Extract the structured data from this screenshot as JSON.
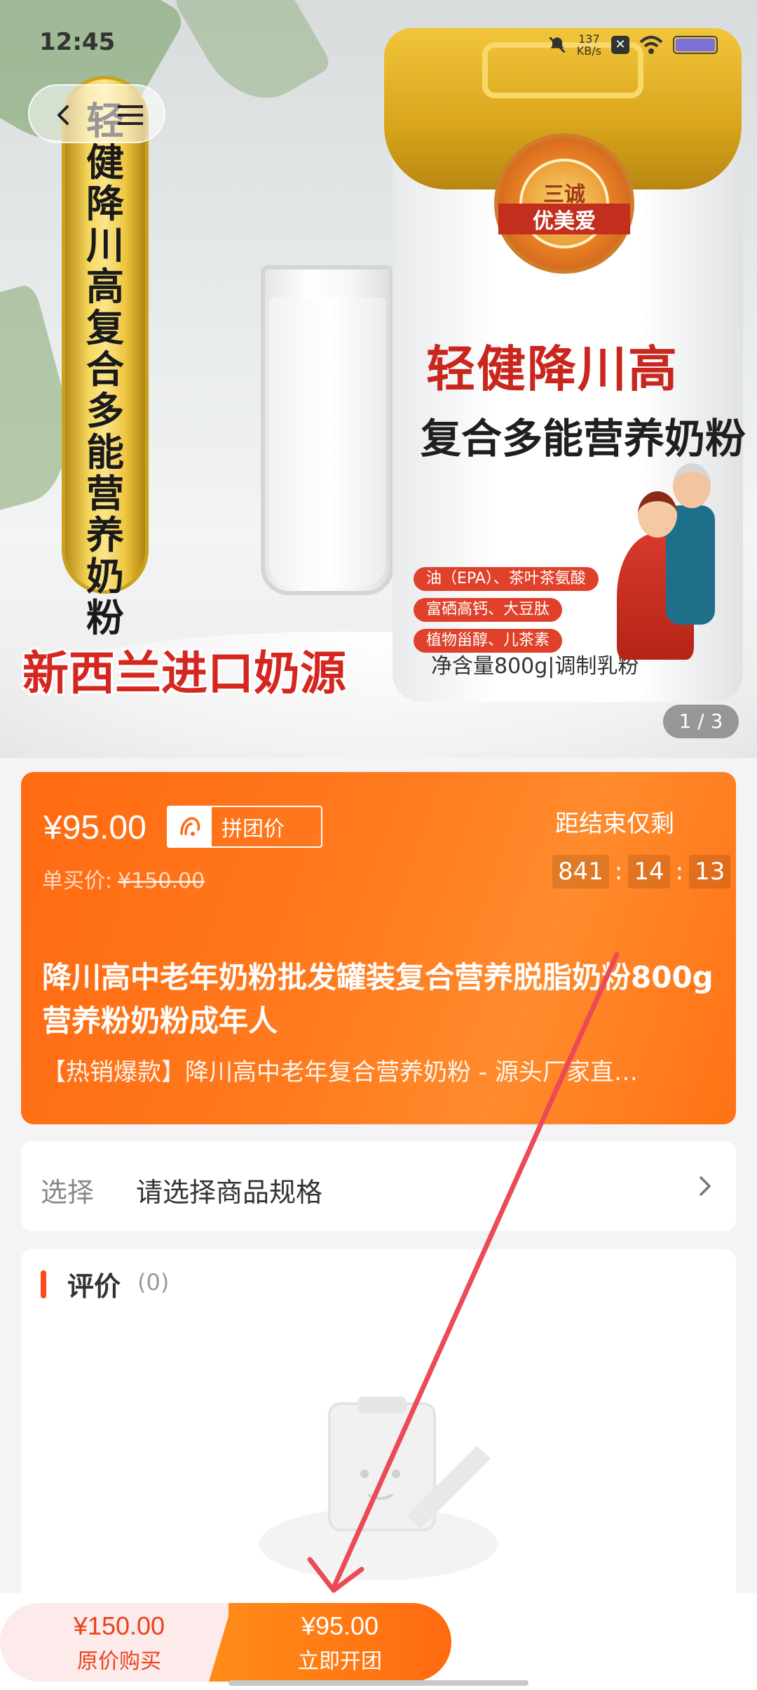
{
  "status_bar": {
    "time": "12:45",
    "speed_value": "137",
    "speed_unit": "KB/s",
    "icons": [
      "mute-bell-icon",
      "x-app-icon",
      "wifi-icon",
      "battery-icon"
    ]
  },
  "hero": {
    "banner_text": "轻健降川高复合多能营养奶粉",
    "can_brand_line1": "三诚",
    "can_brand_line2": "优美爱",
    "can_title1": "轻健降川高",
    "can_title2": "复合多能营养奶粉",
    "can_features": [
      "油（EPA）、茶叶茶氨酸",
      "富硒高钙、大豆肽",
      "植物甾醇、儿茶素"
    ],
    "can_net": "净含量800g|调制乳粉",
    "subtitle": "新西兰进口奶源",
    "pager": "1 / 3"
  },
  "price_card": {
    "group_price": "¥95.00",
    "group_tag": "拼团价",
    "single_label": "单买价:",
    "single_price": "¥150.00",
    "countdown_label": "距结束仅剩",
    "countdown": {
      "hours": "841",
      "minutes": "14",
      "seconds": "13"
    },
    "title": "降川高中老年奶粉批发罐装复合营养脱脂奶粉800g 营养粉奶粉成年人",
    "subtitle": "【热销爆款】降川高中老年复合营养奶粉 - 源头厂家直…"
  },
  "spec": {
    "key": "选择",
    "value": "请选择商品规格"
  },
  "review": {
    "title": "评价",
    "count": "(0)"
  },
  "bottom_bar": {
    "left_price": "¥150.00",
    "left_label": "原价购买",
    "right_price": "¥95.00",
    "right_label": "立即开团"
  },
  "colors": {
    "accent": "#ff6a12",
    "annotation_arrow": "#ec4a55"
  }
}
